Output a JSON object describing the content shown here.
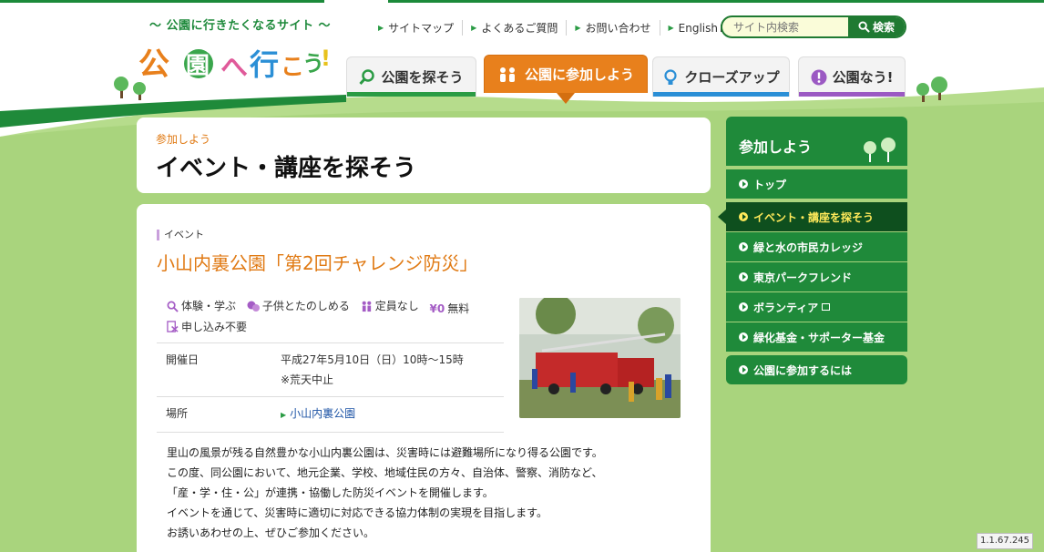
{
  "header": {
    "tagline": "〜 公園に行きたくなるサイト 〜",
    "logo_text": "公園へ行こう!",
    "utility_links": [
      {
        "label": "サイトマップ"
      },
      {
        "label": "よくあるご質問"
      },
      {
        "label": "お問い合わせ"
      },
      {
        "label": "English"
      }
    ],
    "search": {
      "placeholder": "サイト内検索",
      "button_label": "検索"
    }
  },
  "nav": {
    "tabs": [
      {
        "label": "公園を探そう",
        "icon": "magnifier-icon"
      },
      {
        "label": "公園に参加しよう",
        "icon": "people-icon",
        "active": true
      },
      {
        "label": "クローズアップ",
        "icon": "lightbulb-icon"
      },
      {
        "label": "公園なう!",
        "icon": "exclamation-icon"
      }
    ]
  },
  "title_panel": {
    "breadcrumb": "参加しよう",
    "title": "イベント・講座を探そう"
  },
  "event": {
    "category": "イベント",
    "title": "小山内裏公園「第2回チャレンジ防災」",
    "tags": [
      {
        "icon": "magnifier-icon",
        "label": "体験・学ぶ"
      },
      {
        "icon": "children-icon",
        "label": "子供とたのしめる"
      },
      {
        "icon": "people-icon",
        "label": "定員なし"
      },
      {
        "icon": "yen-icon",
        "icon_text": "¥0",
        "label": "無料"
      },
      {
        "icon": "no-application-icon",
        "label": "申し込み不要"
      }
    ],
    "info": {
      "date_label": "開催日",
      "date_value": "平成27年5月10日（日）10時〜15時",
      "date_note": "※荒天中止",
      "place_label": "場所",
      "place_value": "小山内裏公園"
    },
    "description": [
      "里山の風景が残る自然豊かな小山内裏公園は、災害時には避難場所になり得る公園です。",
      "この度、同公園において、地元企業、学校、地域住民の方々、自治体、警察、消防など、",
      "「産・学・住・公」が連携・協働した防災イベントを開催します。",
      "イベントを通じて、災害時に適切に対応できる協力体制の実現を目指します。",
      "お誘いあわせの上、ぜひご参加ください。"
    ]
  },
  "sidebar": {
    "heading": "参加しよう",
    "items": [
      {
        "label": "トップ"
      },
      {
        "label": "イベント・講座を探そう",
        "active": true
      },
      {
        "label": "緑と水の市民カレッジ"
      },
      {
        "label": "東京パークフレンド"
      },
      {
        "label": "ボランティア",
        "external": true
      },
      {
        "label": "緑化基金・サポーター基金"
      },
      {
        "label": "公園に参加するには"
      }
    ]
  },
  "version": "1.1.67.245",
  "colors": {
    "brand_green": "#1f8a3a",
    "dark_green": "#0e4f1e",
    "accent_orange": "#e8801c",
    "active_text": "#ffe95a",
    "hill_green": "#b6dc8c"
  }
}
